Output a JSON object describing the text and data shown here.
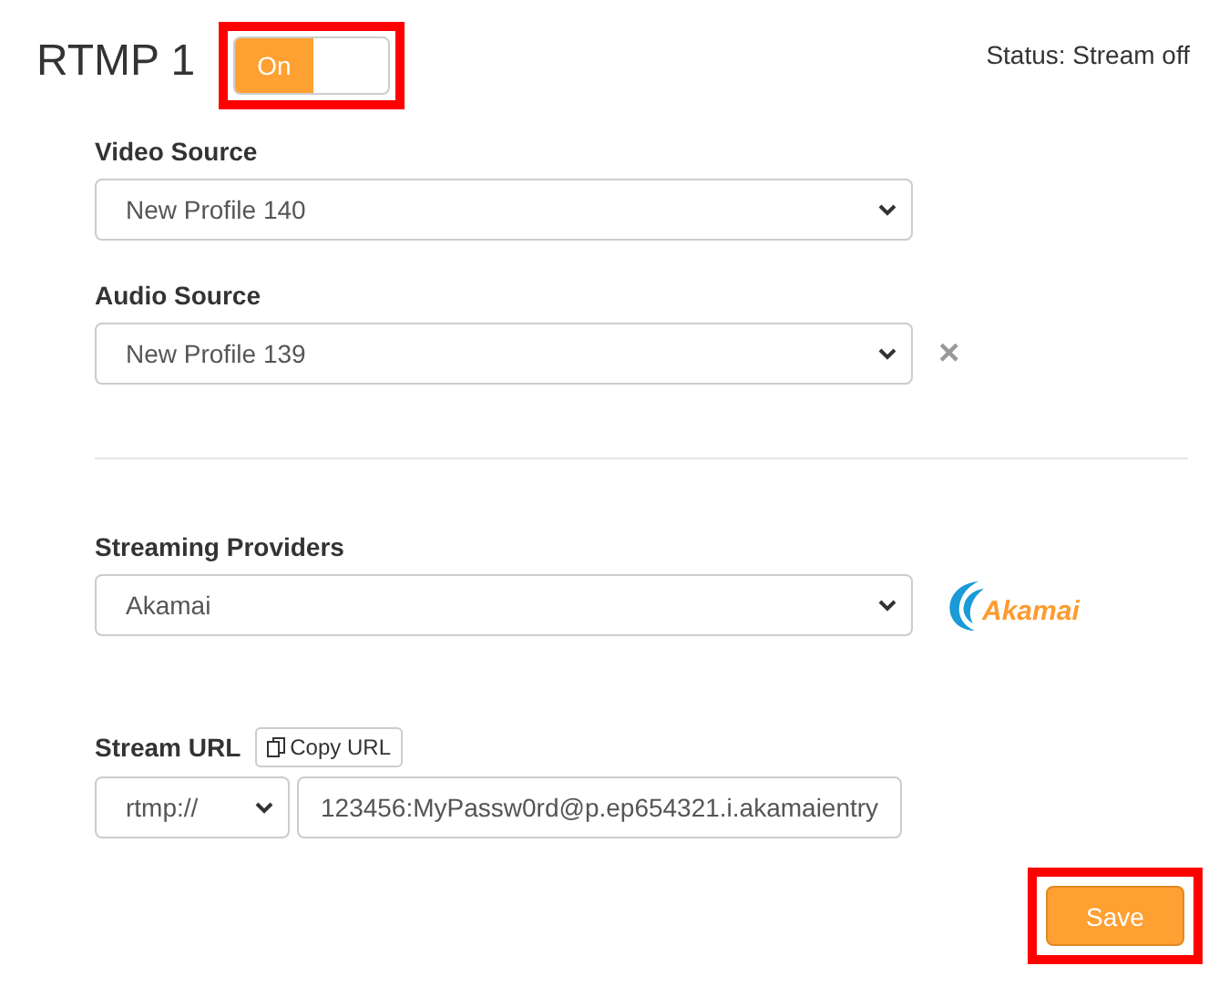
{
  "title": "RTMP 1",
  "toggle": {
    "label": "On",
    "on": true,
    "highlighted": true
  },
  "status": "Status: Stream off",
  "video_source": {
    "label": "Video Source",
    "value": "New Profile 140"
  },
  "audio_source": {
    "label": "Audio Source",
    "value": "New Profile 139",
    "clear": "×"
  },
  "streaming_providers": {
    "label": "Streaming Providers",
    "value": "Akamai",
    "logo_text": "Akamai"
  },
  "stream_url": {
    "label": "Stream URL",
    "copy_button": "Copy URL",
    "protocol": "rtmp://",
    "value": "123456:MyPassw0rd@p.ep654321.i.akamaientry"
  },
  "save_button": {
    "label": "Save",
    "highlighted": true
  }
}
